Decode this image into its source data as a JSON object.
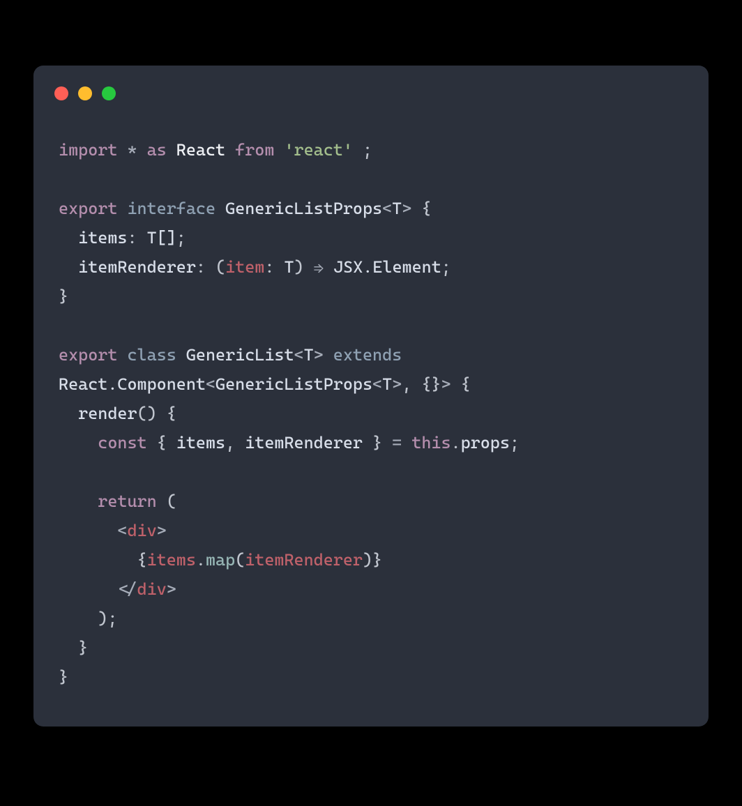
{
  "colors": {
    "background": "#000000",
    "window_bg": "#2b303b",
    "traffic_red": "#ff5f56",
    "traffic_yellow": "#ffbd2e",
    "traffic_green": "#27c93f",
    "token_keyword": "#b48ead",
    "token_storage": "#8fa1b3",
    "token_default": "#c0c5ce",
    "token_white": "#eff1f5",
    "token_string": "#a3be8c",
    "token_variable": "#bf616a",
    "token_teal": "#96b5b4"
  },
  "tokens": {
    "import": "import",
    "star": "*",
    "as": "as",
    "react": "React",
    "from": "from",
    "str_react": "'react'",
    "semi": ";",
    "export": "export",
    "interface": "interface",
    "genericlistprops": "GenericListProps",
    "lt": "<",
    "gt": ">",
    "t": "T",
    "obrace": "{",
    "cbrace": "}",
    "items": "items",
    "colon": ":",
    "tbrackets": "T[]",
    "itemrenderer": "itemRenderer",
    "oparen": "(",
    "cparen": ")",
    "item": "item",
    "arrow": "⇒",
    "jsx_element": "JSX.Element",
    "class": "class",
    "genericlist": "GenericList",
    "extends": "extends",
    "react_component": "React.Component",
    "emptyobj": "{}",
    "comma": ",",
    "render": "render",
    "const": "const",
    "eq": "=",
    "this": "this",
    "dot": ".",
    "props": "props",
    "return": "return",
    "div_open": "div",
    "slash": "/",
    "map": "map"
  },
  "code_plain": "import * as React from 'react' ;\n\nexport interface GenericListProps<T> {\n  items: T[];\n  itemRenderer: (item: T) ⇒ JSX.Element;\n}\n\nexport class GenericList<T> extends\nReact.Component<GenericListProps<T>, {}> {\n  render() {\n    const { items, itemRenderer } = this.props;\n\n    return (\n      <div>\n        {items.map(itemRenderer)}\n      </div>\n    );\n  }\n}"
}
